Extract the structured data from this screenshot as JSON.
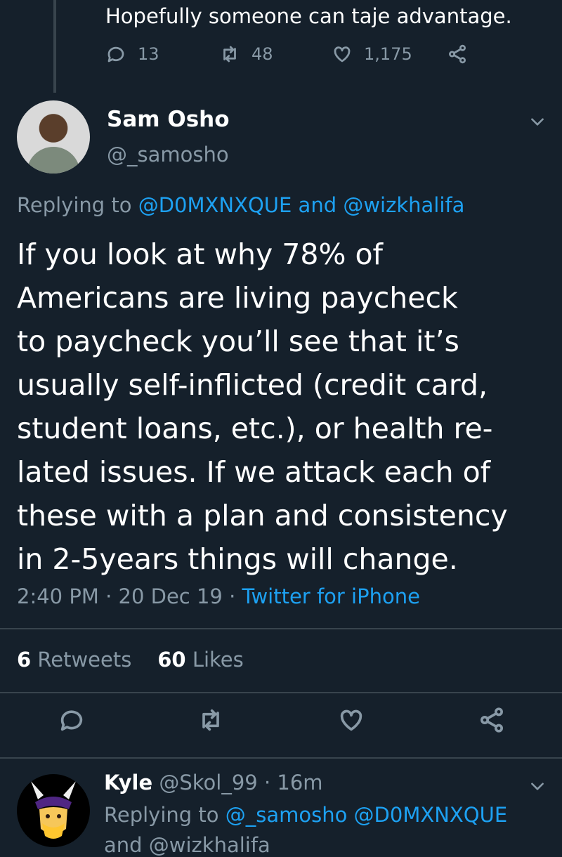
{
  "previous_tweet": {
    "text": "Hopefully someone can taje advantage.",
    "reply_count": "13",
    "retweet_count": "48",
    "like_count": "1,175"
  },
  "main_tweet": {
    "author_name": "Sam Osho",
    "author_handle": "@_samosho",
    "replying_prefix": "Replying to",
    "reply_to_1": "@D0MXNXQUE",
    "reply_joiner": "and",
    "reply_to_2": "@wizkhalifa",
    "lines": [
      "If you look at why 78% of",
      "Americans are living paycheck",
      "to paycheck you’ll see that it’s",
      "usually self-inflicted (credit card,",
      "student loans, etc.), or health re-",
      "lated issues. If we attack each of",
      "these with a plan and consistency",
      "in 2-5years things will change."
    ],
    "time": "2:40 PM",
    "date": "20 Dec 19",
    "separator": "·",
    "source": "Twitter for iPhone",
    "retweets_count": "6",
    "retweets_label": "Retweets",
    "likes_count": "60",
    "likes_label": "Likes"
  },
  "next_tweet": {
    "author_name": "Kyle",
    "author_handle": "@Skol_99",
    "separator": "·",
    "time_ago": "16m",
    "replying_prefix": "Replying to",
    "reply_to_1": "@_samosho",
    "reply_to_2": "@D0MXNXQUE",
    "line3_partial": "and @wizkhalifa"
  },
  "colors": {
    "background": "#15202b",
    "text": "#ffffff",
    "muted": "#8899a6",
    "link": "#1da1f2",
    "divider": "#38444d"
  },
  "icons": [
    "reply-icon",
    "retweet-icon",
    "like-icon",
    "share-icon",
    "chevron-down-icon"
  ]
}
